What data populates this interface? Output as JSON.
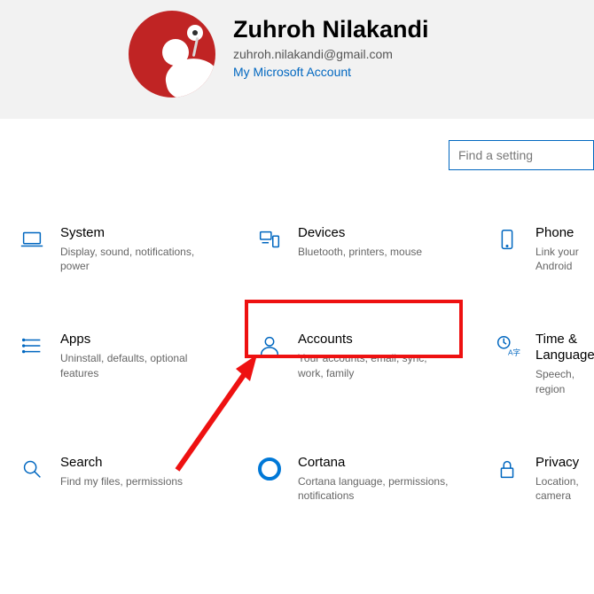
{
  "header": {
    "name": "Zuhroh Nilakandi",
    "email": "zuhroh.nilakandi@gmail.com",
    "msa_link": "My Microsoft Account"
  },
  "search": {
    "placeholder": "Find a setting"
  },
  "cards": {
    "system": {
      "title": "System",
      "desc": "Display, sound, notifications, power"
    },
    "devices": {
      "title": "Devices",
      "desc": "Bluetooth, printers, mouse"
    },
    "phone": {
      "title": "Phone",
      "desc": "Link your Android"
    },
    "apps": {
      "title": "Apps",
      "desc": "Uninstall, defaults, optional features"
    },
    "accounts": {
      "title": "Accounts",
      "desc": "Your accounts, email, sync, work, family"
    },
    "time": {
      "title": "Time & Language",
      "desc": "Speech, region"
    },
    "search": {
      "title": "Search",
      "desc": "Find my files, permissions"
    },
    "cortana": {
      "title": "Cortana",
      "desc": "Cortana language, permissions, notifications"
    },
    "privacy": {
      "title": "Privacy",
      "desc": "Location, camera"
    }
  }
}
